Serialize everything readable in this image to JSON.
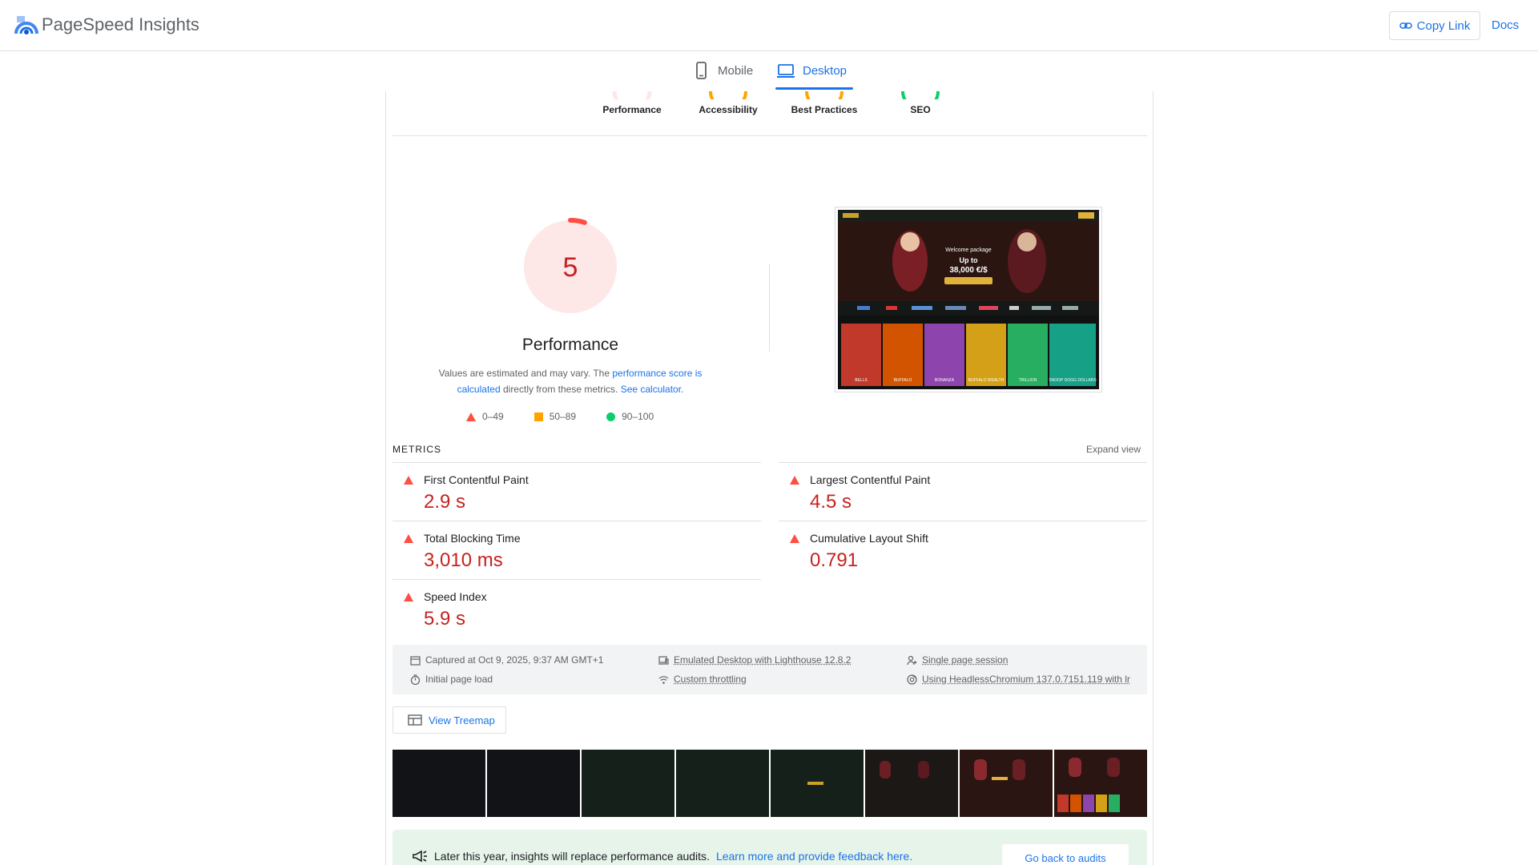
{
  "app": {
    "title": "PageSpeed Insights"
  },
  "header": {
    "copy_link": "Copy Link",
    "docs": "Docs"
  },
  "device_tabs": [
    {
      "label": "Mobile",
      "icon": "phone-icon",
      "selected": false
    },
    {
      "label": "Desktop",
      "icon": "laptop-icon",
      "selected": true
    }
  ],
  "category_gauges": [
    {
      "label": "Performance",
      "color": "#ff4e42"
    },
    {
      "label": "Accessibility",
      "color": "#ffa400"
    },
    {
      "label": "Best Practices",
      "color": "#ffa400"
    },
    {
      "label": "SEO",
      "color": "#0cce6b"
    }
  ],
  "performance": {
    "score": "5",
    "score_fraction": 0.05,
    "title": "Performance",
    "desc_prefix": "Values are estimated and may vary. The ",
    "desc_link1": "performance score is calculated",
    "desc_middle": " directly from these metrics. ",
    "desc_link2": "See calculator.",
    "colors": {
      "fail": "#ff4e42",
      "fail_bg": "#fde8e7",
      "fail_text": "#c5221f",
      "average": "#ffa400",
      "pass": "#0cce6b"
    }
  },
  "legend": [
    {
      "range": "0–49",
      "icon": "red-triangle-icon"
    },
    {
      "range": "50–89",
      "icon": "orange-square-icon"
    },
    {
      "range": "90–100",
      "icon": "green-circle-icon"
    }
  ],
  "metrics": {
    "title": "METRICS",
    "expand": "Expand view",
    "items": [
      {
        "name": "First Contentful Paint",
        "value": "2.9 s"
      },
      {
        "name": "Largest Contentful Paint",
        "value": "4.5 s"
      },
      {
        "name": "Total Blocking Time",
        "value": "3,010 ms"
      },
      {
        "name": "Cumulative Layout Shift",
        "value": "0.791"
      },
      {
        "name": "Speed Index",
        "value": "5.9 s"
      }
    ]
  },
  "run_info": {
    "captured": "Captured at Oct 9, 2025, 9:37 AM GMT+1",
    "page_load": "Initial page load",
    "emulated": "Emulated Desktop with Lighthouse 12.8.2",
    "throttling": "Custom throttling",
    "session": "Single page session",
    "browser": "Using HeadlessChromium 137.0.7151.119 with lr"
  },
  "treemap": {
    "label": "View Treemap"
  },
  "screenshot_preview": {
    "welcome": "Welcome package",
    "up_to": "Up to",
    "amount": "38,000 €/$",
    "games": [
      "BELLS",
      "BUFFALO",
      "BONANZA",
      "BUFFALO WEALTH",
      "TRILLION",
      "SNOOP DOGG DOLLARS"
    ]
  },
  "banner": {
    "text": "Later this year, insights will replace performance audits.",
    "link": "Learn more and provide feedback here.",
    "button": "Go back to audits"
  }
}
